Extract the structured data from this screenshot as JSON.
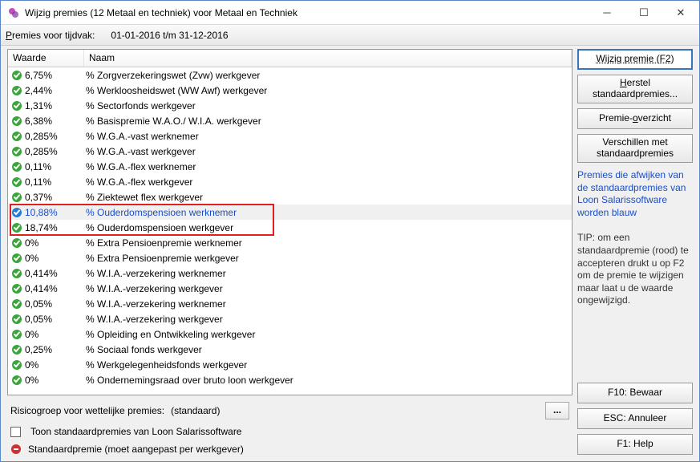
{
  "window": {
    "title": "Wijzig premies (12 Metaal en techniek) voor Metaal en Techniek"
  },
  "toolbar": {
    "label_html": "Premies voor tijdvak:",
    "value": "01-01-2016 t/m 31-12-2016"
  },
  "grid": {
    "headers": {
      "waarde": "Waarde",
      "naam": "Naam"
    },
    "rows": [
      {
        "icon": "green",
        "value": "6,75%",
        "name": "% Zorgverzekeringswet (Zvw) werkgever"
      },
      {
        "icon": "green",
        "value": "2,44%",
        "name": "% Werkloosheidswet (WW Awf) werkgever"
      },
      {
        "icon": "green",
        "value": "1,31%",
        "name": "% Sectorfonds werkgever"
      },
      {
        "icon": "green",
        "value": "6,38%",
        "name": "% Basispremie W.A.O./ W.I.A. werkgever"
      },
      {
        "icon": "green",
        "value": "0,285%",
        "name": "% W.G.A.-vast werknemer"
      },
      {
        "icon": "green",
        "value": "0,285%",
        "name": "% W.G.A.-vast werkgever"
      },
      {
        "icon": "green",
        "value": "0,11%",
        "name": "% W.G.A.-flex werknemer"
      },
      {
        "icon": "green",
        "value": "0,11%",
        "name": "% W.G.A.-flex werkgever"
      },
      {
        "icon": "green",
        "value": "0,37%",
        "name": "% Ziektewet flex werkgever"
      },
      {
        "icon": "blue",
        "value": "10,88%",
        "name": "% Ouderdomspensioen werknemer",
        "selected": true
      },
      {
        "icon": "green",
        "value": "18,74%",
        "name": "% Ouderdomspensioen werkgever"
      },
      {
        "icon": "green",
        "value": "0%",
        "name": "% Extra Pensioenpremie werknemer"
      },
      {
        "icon": "green",
        "value": "0%",
        "name": "% Extra Pensioenpremie werkgever"
      },
      {
        "icon": "green",
        "value": "0,414%",
        "name": "% W.I.A.-verzekering werknemer"
      },
      {
        "icon": "green",
        "value": "0,414%",
        "name": "% W.I.A.-verzekering werkgever"
      },
      {
        "icon": "green",
        "value": "0,05%",
        "name": "% W.I.A.-verzekering werknemer"
      },
      {
        "icon": "green",
        "value": "0,05%",
        "name": "% W.I.A.-verzekering werkgever"
      },
      {
        "icon": "green",
        "value": "0%",
        "name": "% Opleiding en Ontwikkeling werkgever"
      },
      {
        "icon": "green",
        "value": "0,25%",
        "name": "% Sociaal fonds werkgever"
      },
      {
        "icon": "green",
        "value": "0%",
        "name": "% Werkgelegenheidsfonds werkgever"
      },
      {
        "icon": "green",
        "value": "0%",
        "name": "% Ondernemingsraad over bruto loon werkgever"
      }
    ],
    "highlight": {
      "start": 9,
      "end": 10
    }
  },
  "footer": {
    "risk_label": "Risicogroep voor wettelijke premies:",
    "risk_value": "(standaard)",
    "checkbox_label": "Toon standaardpremies van Loon Salarissoftware",
    "legend_error": "Standaardpremie (moet aangepast per werkgever)"
  },
  "side": {
    "btn_wijzig": "Wijzig premie (F2)",
    "btn_herstel": "Herstel standaardpremies...",
    "btn_overzicht": "Premie-overzicht",
    "btn_versch": "Verschillen met standaardpremies",
    "info_blue": "Premies die afwijken van de standaardpremies van Loon Salarissoftware worden blauw",
    "tip": "TIP: om een standaardpremie (rood) te accepteren drukt u op F2 om de premie te wijzigen maar laat u de waarde ongewijzigd.",
    "btn_f10": "F10: Bewaar",
    "btn_esc": "ESC: Annuleer",
    "btn_f1": "F1: Help"
  }
}
